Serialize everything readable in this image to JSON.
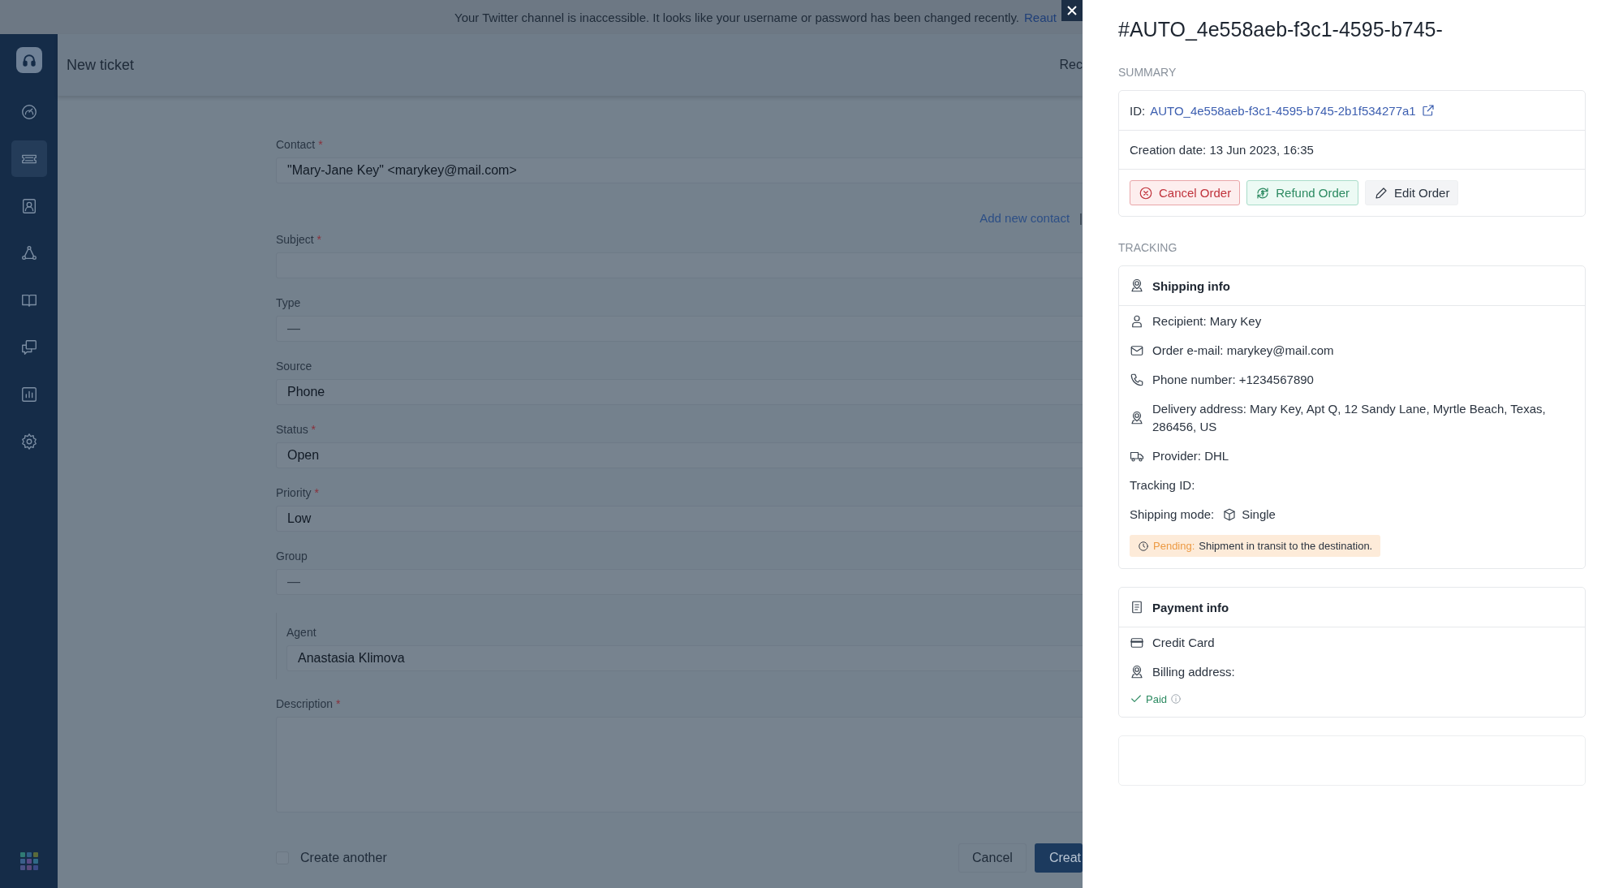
{
  "banner": {
    "message": "Your Twitter channel is inaccessible. It looks like your username or password has been changed recently.",
    "link": "Reaut"
  },
  "sidebar": {
    "items": [
      {
        "kind": "dashboard",
        "selected": false
      },
      {
        "kind": "tickets",
        "selected": true
      },
      {
        "kind": "contacts",
        "selected": false
      },
      {
        "kind": "network",
        "selected": false
      },
      {
        "kind": "knowledge",
        "selected": false
      },
      {
        "kind": "chat",
        "selected": false
      },
      {
        "kind": "reports",
        "selected": false
      },
      {
        "kind": "settings",
        "selected": false
      }
    ]
  },
  "header": {
    "title": "New ticket",
    "action": "Rec"
  },
  "form": {
    "fields": [
      {
        "kind": "input",
        "label": "Contact",
        "marker": "*",
        "value": "\"Mary-Jane Key\" <marykey@mail.com>"
      },
      {
        "kind": "input",
        "label": "Subject",
        "marker": "*"
      },
      {
        "kind": "input",
        "label": "Type",
        "placeholder": "—"
      },
      {
        "kind": "input",
        "label": "Source",
        "value": "Phone"
      },
      {
        "kind": "input",
        "label": "Status",
        "marker": "*",
        "value": "Open"
      },
      {
        "kind": "input",
        "label": "Priority",
        "marker": "*",
        "value": "Low"
      },
      {
        "kind": "input",
        "label": "Group",
        "placeholder": "—"
      },
      {
        "kind": "grouped",
        "label": "Agent",
        "value": "Anastasia Klimova"
      },
      {
        "kind": "textarea",
        "label": "Description",
        "marker": "*"
      }
    ],
    "add_contact": {
      "link": "Add new contact",
      "separator": "|"
    },
    "create_another": {
      "label": "Create another",
      "checked": false
    },
    "buttons": [
      {
        "label": "Cancel",
        "kind": "secondary"
      },
      {
        "label": "Creat",
        "kind": "primary"
      }
    ]
  },
  "drawer": {
    "title": "#AUTO_4e558aeb-f3c1-4595-b745-",
    "summary": {
      "heading": "SUMMARY",
      "id_label": "ID:",
      "id_link": "AUTO_4e558aeb-f3c1-4595-b745-2b1f534277a1",
      "creation": "Creation date: 13 Jun 2023, 16:35",
      "actions": [
        {
          "label": "Cancel Order",
          "kind": "danger"
        },
        {
          "label": "Refund Order",
          "kind": "success"
        },
        {
          "label": "Edit Order",
          "kind": "neutral"
        }
      ]
    },
    "tracking": {
      "heading": "TRACKING",
      "title": "Shipping info",
      "rows": [
        {
          "kind": "person",
          "text": "Recipient: Mary Key"
        },
        {
          "kind": "mail",
          "text": "Order e-mail: marykey@mail.com"
        },
        {
          "kind": "phone",
          "text": "Phone number: +1234567890"
        },
        {
          "kind": "location",
          "text": "Delivery address: Mary Key, Apt Q, 12 Sandy Lane, Myrtle Beach, Texas, 286456, US"
        },
        {
          "kind": "truck",
          "text": "Provider: DHL"
        },
        {
          "kind": "plain",
          "text": "Tracking ID:"
        },
        {
          "kind": "mode",
          "text": "Shipping mode:",
          "value": "Single"
        }
      ],
      "status": {
        "label": "Pending:",
        "text": "Shipment in transit to the destination."
      }
    },
    "payment": {
      "title": "Payment info",
      "rows": [
        {
          "kind": "card",
          "text": "Credit Card"
        },
        {
          "kind": "location",
          "text": "Billing address:"
        }
      ],
      "paid": "Paid"
    }
  }
}
